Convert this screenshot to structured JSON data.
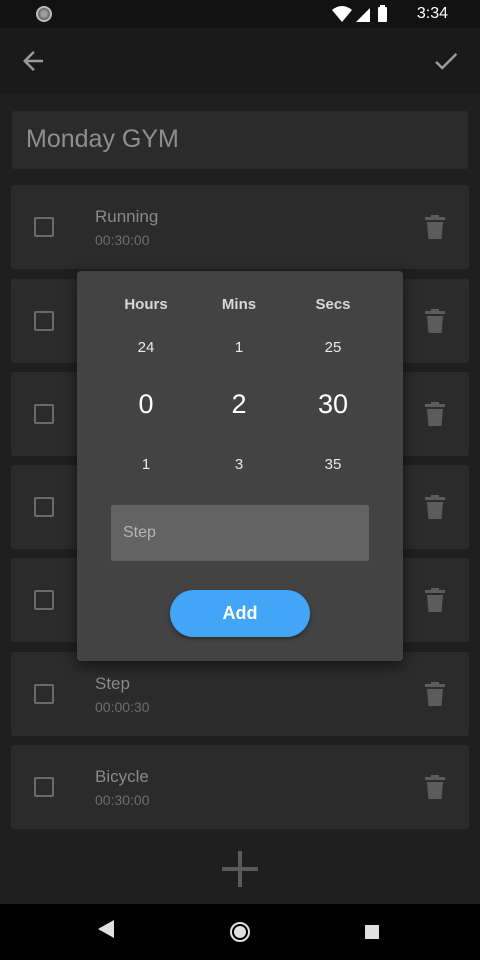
{
  "status_bar": {
    "time": "3:34"
  },
  "workout": {
    "title": "Monday GYM"
  },
  "exercises": [
    {
      "name": "Running",
      "duration": "00:30:00"
    },
    {
      "name": "",
      "duration": ""
    },
    {
      "name": "",
      "duration": ""
    },
    {
      "name": "",
      "duration": ""
    },
    {
      "name": "",
      "duration": ""
    },
    {
      "name": "Step",
      "duration": "00:00:30"
    },
    {
      "name": "Bicycle",
      "duration": "00:30:00"
    }
  ],
  "dialog": {
    "hours": {
      "label": "Hours",
      "prev": "24",
      "selected": "0",
      "next": "1"
    },
    "mins": {
      "label": "Mins",
      "prev": "1",
      "selected": "2",
      "next": "3"
    },
    "secs": {
      "label": "Secs",
      "prev": "25",
      "selected": "30",
      "next": "35"
    },
    "name_field": {
      "placeholder": "Step",
      "value": ""
    },
    "add_label": "Add"
  },
  "colors": {
    "accent": "#42a5f5",
    "background": "#1f1f1f",
    "card": "#2b2b2b",
    "dialog": "#434343"
  },
  "icons": {
    "back": "arrow-left-icon",
    "confirm": "check-icon",
    "delete": "trash-icon",
    "add": "plus-icon"
  }
}
